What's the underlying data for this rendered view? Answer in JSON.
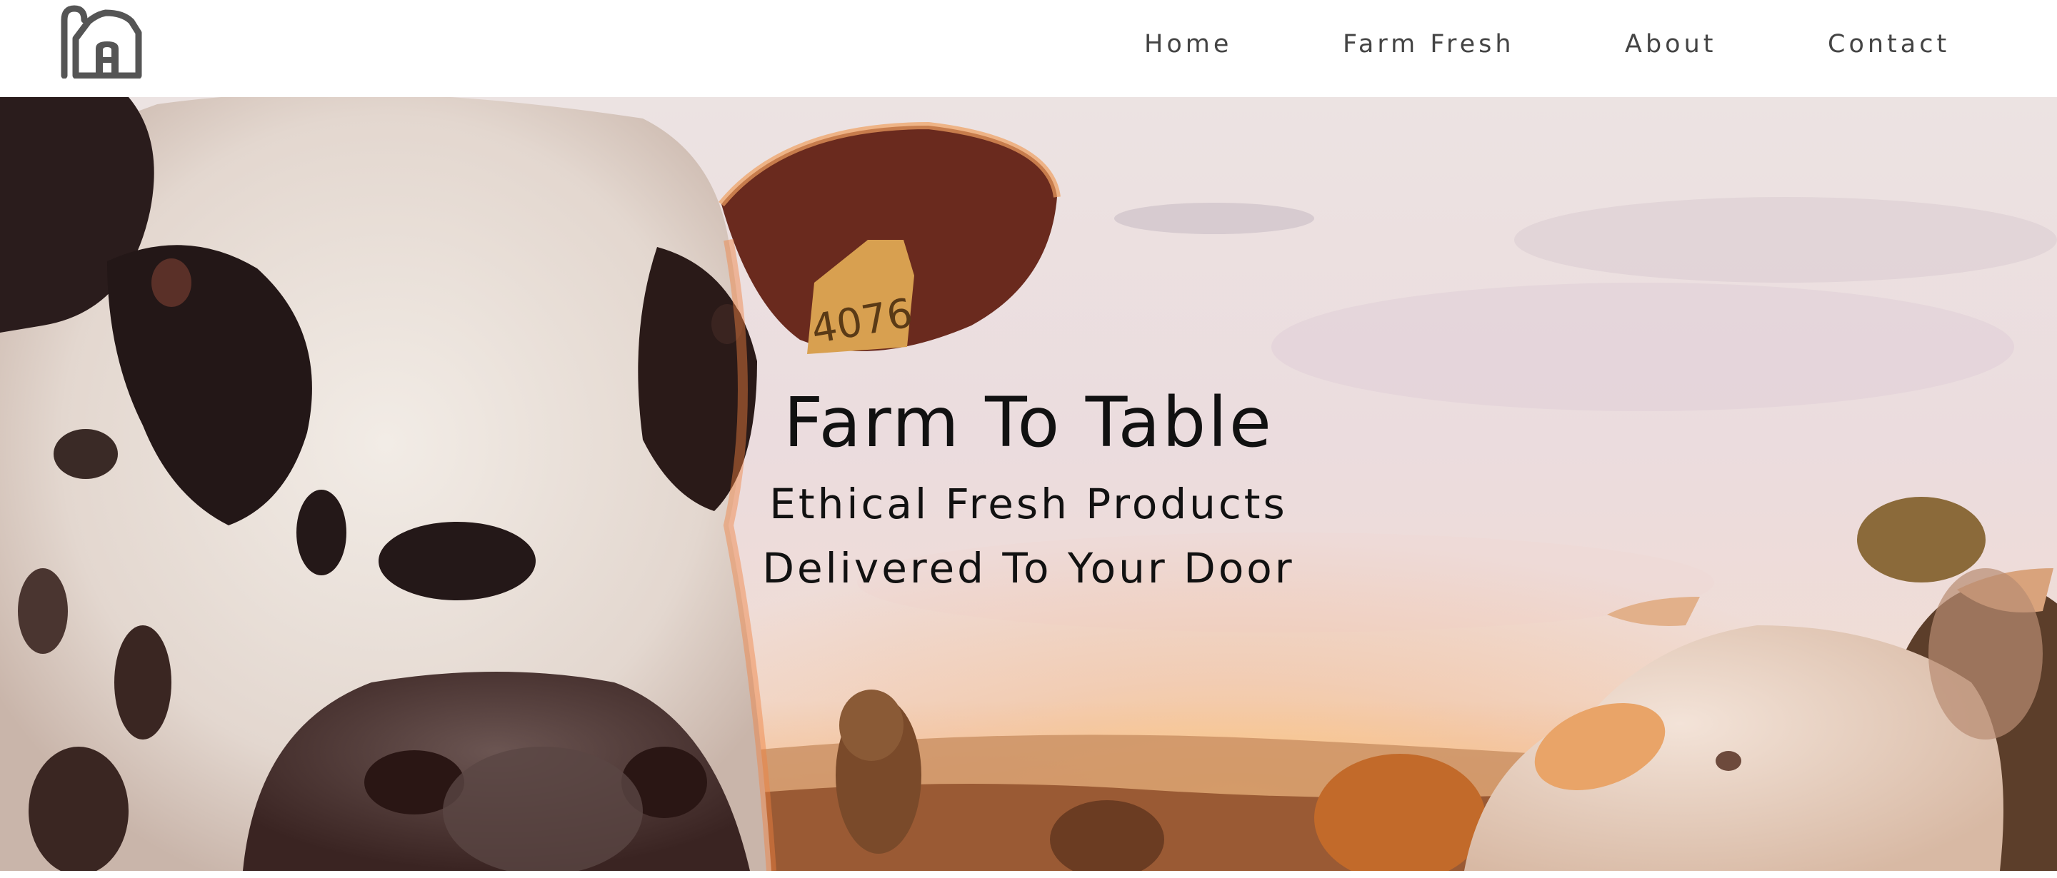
{
  "brand": {
    "logo_icon": "barn-icon"
  },
  "nav": {
    "items": [
      {
        "label": "Home"
      },
      {
        "label": "Farm Fresh"
      },
      {
        "label": "About"
      },
      {
        "label": "Contact"
      }
    ]
  },
  "hero": {
    "title": "Farm To Table",
    "subtitle_line1": "Ethical Fresh Products",
    "subtitle_line2": "Delivered To Your Door",
    "image": "cows-at-sunset-photo"
  },
  "colors": {
    "nav_text": "#444444",
    "hero_text": "#111111",
    "sky": "#eadfe0",
    "sunset": "#f0a050"
  }
}
